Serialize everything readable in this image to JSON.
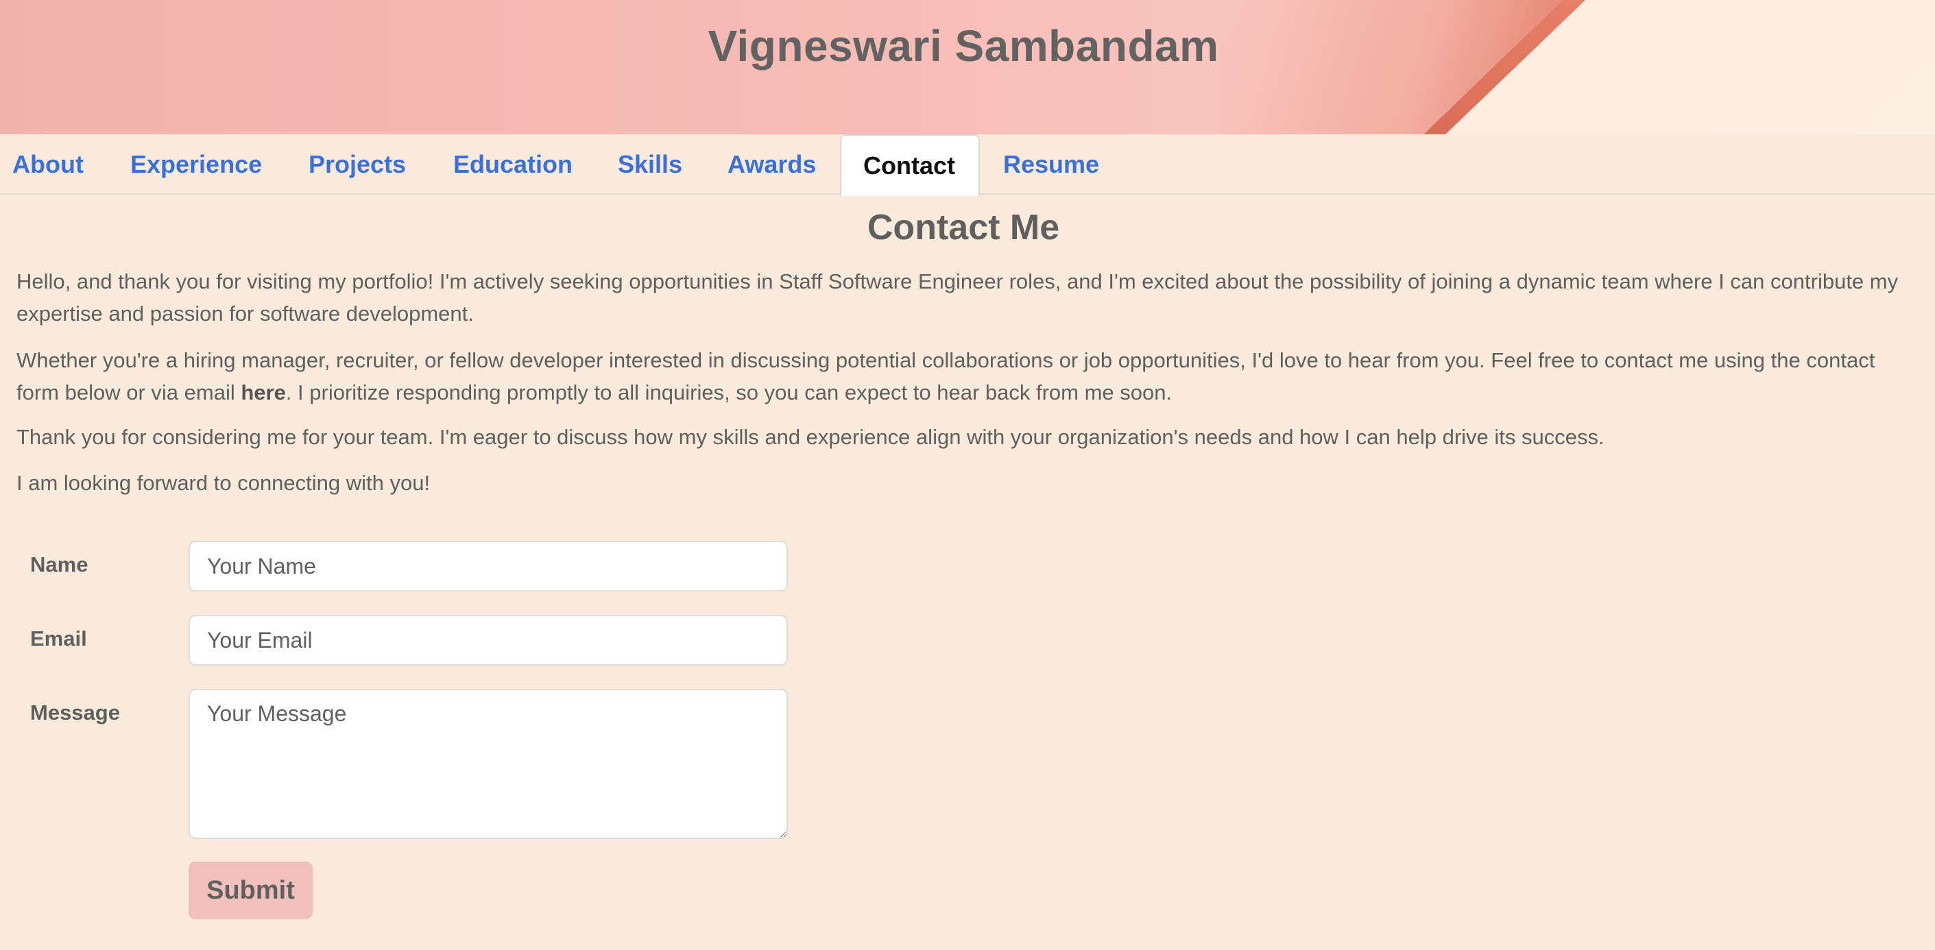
{
  "header": {
    "title": "Vigneswari Sambandam"
  },
  "nav": {
    "tabs": [
      {
        "label": "About"
      },
      {
        "label": "Experience"
      },
      {
        "label": "Projects"
      },
      {
        "label": "Education"
      },
      {
        "label": "Skills"
      },
      {
        "label": "Awards"
      },
      {
        "label": "Contact",
        "active": true
      },
      {
        "label": "Resume"
      }
    ]
  },
  "contact": {
    "title": "Contact Me",
    "p1": "Hello, and thank you for visiting my portfolio! I'm actively seeking opportunities in Staff Software Engineer roles, and I'm excited about the possibility of joining a dynamic team where I can contribute my expertise and passion for software development.",
    "p2_before": "Whether you're a hiring manager, recruiter, or fellow developer interested in discussing potential collaborations or job opportunities, I'd love to hear from you. Feel free to contact me using the contact form below or via email ",
    "p2_link": "here",
    "p2_after": ". I prioritize responding promptly to all inquiries, so you can expect to hear back from me soon.",
    "p3": "Thank you for considering me for your team. I'm eager to discuss how my skills and experience align with your organization's needs and how I can help drive its success.",
    "p4": "I am looking forward to connecting with you!"
  },
  "form": {
    "name_label": "Name",
    "name_placeholder": "Your Name",
    "email_label": "Email",
    "email_placeholder": "Your Email",
    "message_label": "Message",
    "message_placeholder": "Your Message",
    "submit_label": "Submit"
  },
  "colors": {
    "page_background": "#f8ebdc",
    "link": "#3a6fdf",
    "text": "#5f5f5f",
    "submit_background": "#efc0bc",
    "banner_pink": "#f6bcb5",
    "banner_accent": "#d9664f"
  }
}
